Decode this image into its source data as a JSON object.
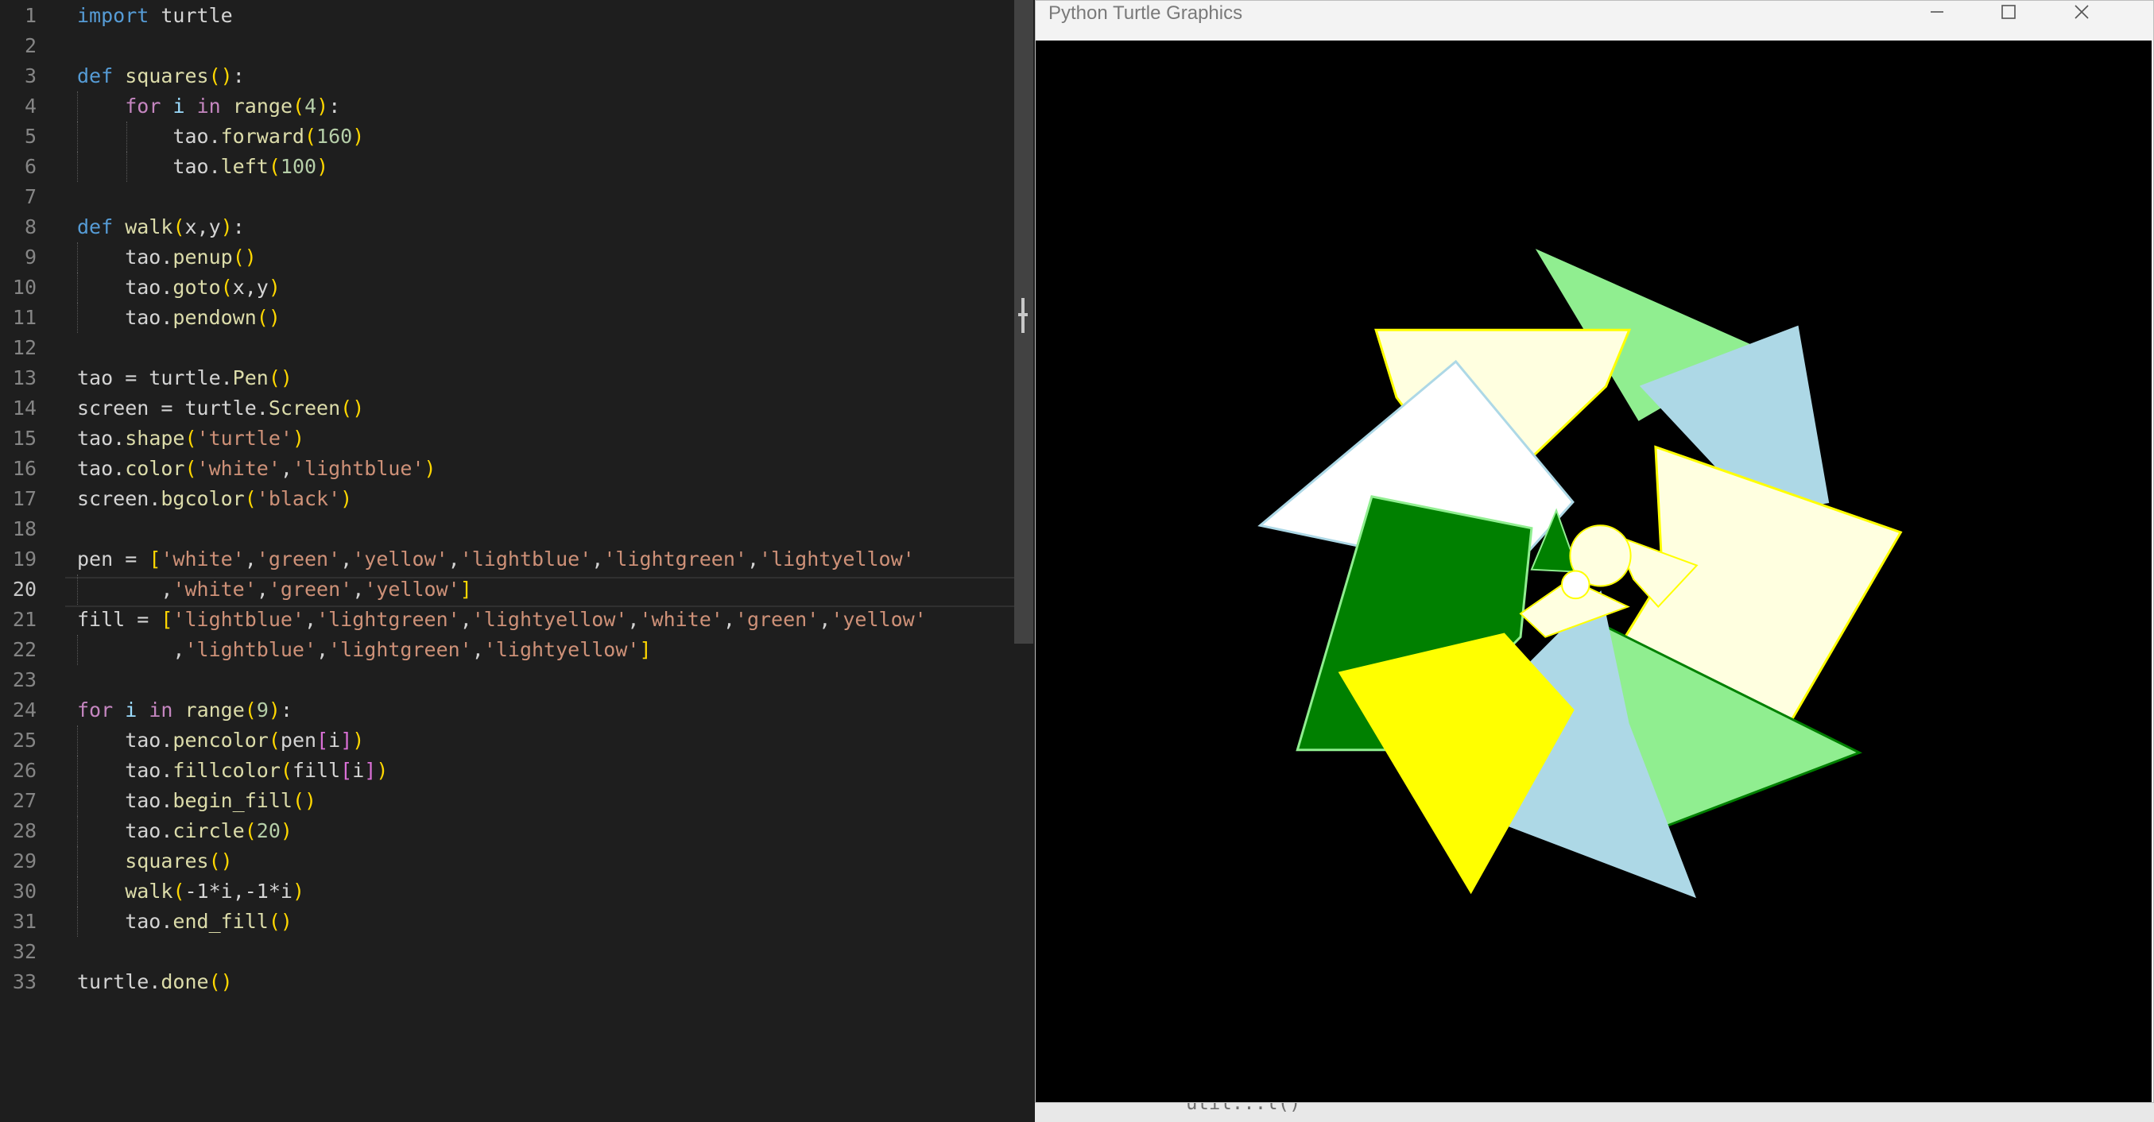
{
  "editor": {
    "current_line": 20,
    "lines": [
      {
        "n": 1,
        "tokens": [
          [
            "import",
            "kw"
          ],
          [
            " turtle",
            ""
          ]
        ]
      },
      {
        "n": 2,
        "tokens": []
      },
      {
        "n": 3,
        "tokens": [
          [
            "def",
            "kw"
          ],
          [
            " ",
            ""
          ],
          [
            "squares",
            "fn"
          ],
          [
            "()",
            "p1"
          ],
          [
            ":",
            ""
          ]
        ]
      },
      {
        "n": 4,
        "guides": [
          1
        ],
        "tokens": [
          [
            "    ",
            ""
          ],
          [
            "for",
            "ctl"
          ],
          [
            " ",
            ""
          ],
          [
            "i",
            "var"
          ],
          [
            " ",
            ""
          ],
          [
            "in",
            "ctl"
          ],
          [
            " ",
            ""
          ],
          [
            "range",
            "fn"
          ],
          [
            "(",
            "p1"
          ],
          [
            "4",
            "num"
          ],
          [
            ")",
            "p1"
          ],
          [
            ":",
            ""
          ]
        ]
      },
      {
        "n": 5,
        "guides": [
          1,
          2
        ],
        "tokens": [
          [
            "        tao.",
            ""
          ],
          [
            "forward",
            "fn"
          ],
          [
            "(",
            "p1"
          ],
          [
            "160",
            "num"
          ],
          [
            ")",
            "p1"
          ]
        ]
      },
      {
        "n": 6,
        "guides": [
          1,
          2
        ],
        "tokens": [
          [
            "        tao.",
            ""
          ],
          [
            "left",
            "fn"
          ],
          [
            "(",
            "p1"
          ],
          [
            "100",
            "num"
          ],
          [
            ")",
            "p1"
          ]
        ]
      },
      {
        "n": 7,
        "tokens": []
      },
      {
        "n": 8,
        "tokens": [
          [
            "def",
            "kw"
          ],
          [
            " ",
            ""
          ],
          [
            "walk",
            "fn"
          ],
          [
            "(",
            "p1"
          ],
          [
            "x,y",
            ""
          ],
          [
            ")",
            "p1"
          ],
          [
            ":",
            ""
          ]
        ]
      },
      {
        "n": 9,
        "guides": [
          1
        ],
        "tokens": [
          [
            "    tao.",
            ""
          ],
          [
            "penup",
            "fn"
          ],
          [
            "()",
            "p1"
          ]
        ]
      },
      {
        "n": 10,
        "guides": [
          1
        ],
        "tokens": [
          [
            "    tao.",
            ""
          ],
          [
            "goto",
            "fn"
          ],
          [
            "(",
            "p1"
          ],
          [
            "x,y",
            ""
          ],
          [
            ")",
            "p1"
          ]
        ]
      },
      {
        "n": 11,
        "guides": [
          1
        ],
        "tokens": [
          [
            "    tao.",
            ""
          ],
          [
            "pendown",
            "fn"
          ],
          [
            "()",
            "p1"
          ]
        ]
      },
      {
        "n": 12,
        "tokens": []
      },
      {
        "n": 13,
        "tokens": [
          [
            "tao = turtle.",
            ""
          ],
          [
            "Pen",
            "fn"
          ],
          [
            "()",
            "p1"
          ]
        ]
      },
      {
        "n": 14,
        "tokens": [
          [
            "screen = turtle.",
            ""
          ],
          [
            "Screen",
            "fn"
          ],
          [
            "()",
            "p1"
          ]
        ]
      },
      {
        "n": 15,
        "tokens": [
          [
            "tao.",
            ""
          ],
          [
            "shape",
            "fn"
          ],
          [
            "(",
            "p1"
          ],
          [
            "'turtle'",
            "str"
          ],
          [
            ")",
            "p1"
          ]
        ]
      },
      {
        "n": 16,
        "tokens": [
          [
            "tao.",
            ""
          ],
          [
            "color",
            "fn"
          ],
          [
            "(",
            "p1"
          ],
          [
            "'white'",
            "str"
          ],
          [
            ",",
            ""
          ],
          [
            "'lightblue'",
            "str"
          ],
          [
            ")",
            "p1"
          ]
        ]
      },
      {
        "n": 17,
        "tokens": [
          [
            "screen.",
            ""
          ],
          [
            "bgcolor",
            "fn"
          ],
          [
            "(",
            "p1"
          ],
          [
            "'black'",
            "str"
          ],
          [
            ")",
            "p1"
          ]
        ]
      },
      {
        "n": 18,
        "tokens": []
      },
      {
        "n": 19,
        "tokens": [
          [
            "pen = ",
            ""
          ],
          [
            "[",
            "p1"
          ],
          [
            "'white'",
            "str"
          ],
          [
            ",",
            ""
          ],
          [
            "'green'",
            "str"
          ],
          [
            ",",
            ""
          ],
          [
            "'yellow'",
            "str"
          ],
          [
            ",",
            ""
          ],
          [
            "'lightblue'",
            "str"
          ],
          [
            ",",
            ""
          ],
          [
            "'lightgreen'",
            "str"
          ],
          [
            ",",
            ""
          ],
          [
            "'lightyellow'",
            "str"
          ]
        ]
      },
      {
        "n": 20,
        "guides": [
          1
        ],
        "tokens": [
          [
            "       ,",
            ""
          ],
          [
            "'white'",
            "str"
          ],
          [
            ",",
            ""
          ],
          [
            "'green'",
            "str"
          ],
          [
            ",",
            ""
          ],
          [
            "'yellow'",
            "str"
          ],
          [
            "]",
            "p1"
          ]
        ]
      },
      {
        "n": 21,
        "tokens": [
          [
            "fill = ",
            ""
          ],
          [
            "[",
            "p1"
          ],
          [
            "'lightblue'",
            "str"
          ],
          [
            ",",
            ""
          ],
          [
            "'lightgreen'",
            "str"
          ],
          [
            ",",
            ""
          ],
          [
            "'lightyellow'",
            "str"
          ],
          [
            ",",
            ""
          ],
          [
            "'white'",
            "str"
          ],
          [
            ",",
            ""
          ],
          [
            "'green'",
            "str"
          ],
          [
            ",",
            ""
          ],
          [
            "'yellow'",
            "str"
          ]
        ]
      },
      {
        "n": 22,
        "guides": [
          1
        ],
        "tokens": [
          [
            "        ,",
            ""
          ],
          [
            "'lightblue'",
            "str"
          ],
          [
            ",",
            ""
          ],
          [
            "'lightgreen'",
            "str"
          ],
          [
            ",",
            ""
          ],
          [
            "'lightyellow'",
            "str"
          ],
          [
            "]",
            "p1"
          ]
        ]
      },
      {
        "n": 23,
        "tokens": []
      },
      {
        "n": 24,
        "tokens": [
          [
            "for",
            "ctl"
          ],
          [
            " ",
            ""
          ],
          [
            "i",
            "var"
          ],
          [
            " ",
            ""
          ],
          [
            "in",
            "ctl"
          ],
          [
            " ",
            ""
          ],
          [
            "range",
            "fn"
          ],
          [
            "(",
            "p1"
          ],
          [
            "9",
            "num"
          ],
          [
            ")",
            "p1"
          ],
          [
            ":",
            ""
          ]
        ]
      },
      {
        "n": 25,
        "guides": [
          1
        ],
        "tokens": [
          [
            "    tao.",
            ""
          ],
          [
            "pencolor",
            "fn"
          ],
          [
            "(",
            "p1"
          ],
          [
            "pen",
            ""
          ],
          [
            "[",
            "p2"
          ],
          [
            "i",
            ""
          ],
          [
            "]",
            "p2"
          ],
          [
            ")",
            "p1"
          ]
        ]
      },
      {
        "n": 26,
        "guides": [
          1
        ],
        "tokens": [
          [
            "    tao.",
            ""
          ],
          [
            "fillcolor",
            "fn"
          ],
          [
            "(",
            "p1"
          ],
          [
            "fill",
            ""
          ],
          [
            "[",
            "p2"
          ],
          [
            "i",
            ""
          ],
          [
            "]",
            "p2"
          ],
          [
            ")",
            "p1"
          ]
        ]
      },
      {
        "n": 27,
        "guides": [
          1
        ],
        "tokens": [
          [
            "    tao.",
            ""
          ],
          [
            "begin_fill",
            "fn"
          ],
          [
            "()",
            "p1"
          ]
        ]
      },
      {
        "n": 28,
        "guides": [
          1
        ],
        "tokens": [
          [
            "    tao.",
            ""
          ],
          [
            "circle",
            "fn"
          ],
          [
            "(",
            "p1"
          ],
          [
            "20",
            "num"
          ],
          [
            ")",
            "p1"
          ]
        ]
      },
      {
        "n": 29,
        "guides": [
          1
        ],
        "tokens": [
          [
            "    ",
            ""
          ],
          [
            "squares",
            "fn"
          ],
          [
            "()",
            "p1"
          ]
        ]
      },
      {
        "n": 30,
        "guides": [
          1
        ],
        "tokens": [
          [
            "    ",
            ""
          ],
          [
            "walk",
            "fn"
          ],
          [
            "(",
            "p1"
          ],
          [
            "-1*i,-1*i",
            ""
          ],
          [
            ")",
            "p1"
          ]
        ]
      },
      {
        "n": 31,
        "guides": [
          1
        ],
        "tokens": [
          [
            "    tao.",
            ""
          ],
          [
            "end_fill",
            "fn"
          ],
          [
            "()",
            "p1"
          ]
        ]
      },
      {
        "n": 32,
        "tokens": []
      },
      {
        "n": 33,
        "tokens": [
          [
            "turtle.",
            ""
          ],
          [
            "done",
            "fn"
          ],
          [
            "()",
            "p1"
          ]
        ]
      }
    ]
  },
  "turtle_window": {
    "title": "Python Turtle Graphics",
    "background": "#000000",
    "shapes": [
      {
        "fill": "#90ee90",
        "stroke": "#90ee90"
      },
      {
        "fill": "#add8e6",
        "stroke": "#add8e6"
      },
      {
        "fill": "#ffffe0",
        "stroke": "#ffff00"
      },
      {
        "fill": "#ffffff",
        "stroke": "#add8e6"
      },
      {
        "fill": "#008000",
        "stroke": "#90ee90"
      },
      {
        "fill": "#ffffe0",
        "stroke": "#ffff00"
      },
      {
        "fill": "#90ee90",
        "stroke": "#008000"
      },
      {
        "fill": "#add8e6",
        "stroke": "#add8e6"
      },
      {
        "fill": "#ffff00",
        "stroke": "#ffff00"
      }
    ]
  },
  "bottom_strip": {
    "text": "util...l()"
  }
}
